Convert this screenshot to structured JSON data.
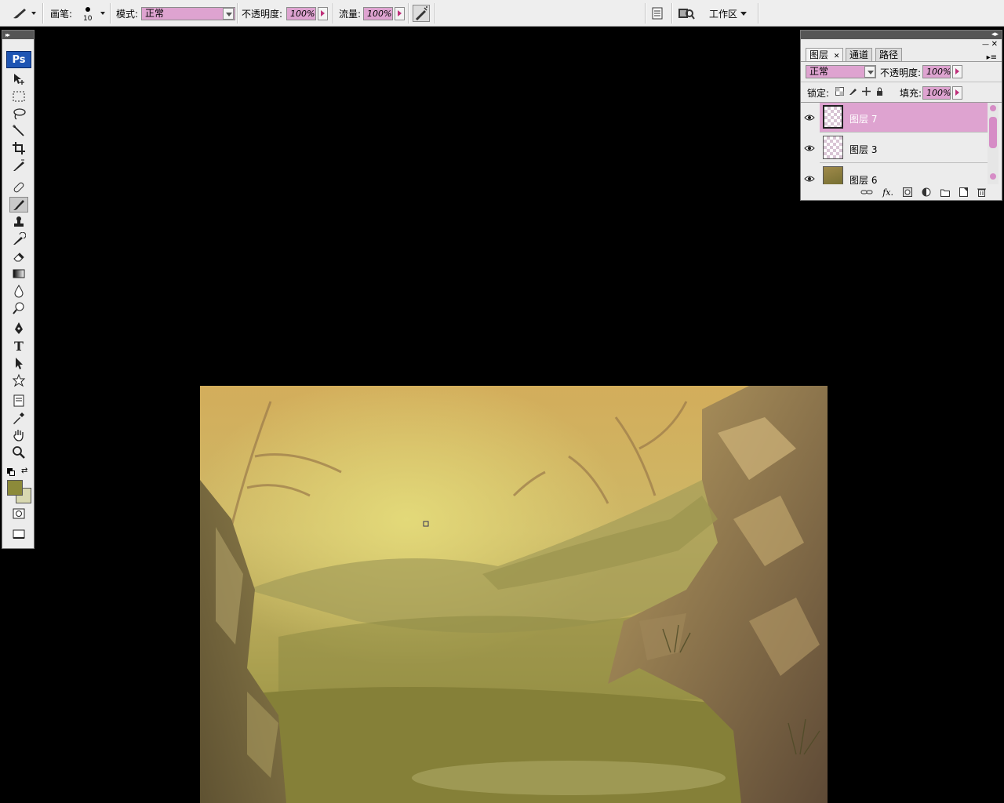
{
  "options_bar": {
    "brush_label": "画笔:",
    "brush_size": "10",
    "mode_label": "模式:",
    "mode_value": "正常",
    "opacity_label": "不透明度:",
    "opacity_value": "100%",
    "flow_label": "流量:",
    "flow_value": "100%",
    "workspace_label": "工作区"
  },
  "tools": {
    "logo": "Ps",
    "items": [
      "move-tool",
      "rectangular-marquee-tool",
      "lasso-tool",
      "magic-wand-tool",
      "crop-tool",
      "slice-tool",
      "healing-brush-tool",
      "brush-tool",
      "clone-stamp-tool",
      "history-brush-tool",
      "eraser-tool",
      "gradient-tool",
      "blur-tool",
      "dodge-tool",
      "pen-tool",
      "type-tool",
      "path-selection-tool",
      "custom-shape-tool",
      "notes-tool",
      "eyedropper-tool",
      "hand-tool",
      "zoom-tool"
    ],
    "selected": "brush-tool",
    "text_tool_glyph": "T",
    "foreground_color": "#8c8a3a",
    "background_color": "#d8d8b0"
  },
  "layers_panel": {
    "tabs": [
      {
        "label": "图层",
        "active": true
      },
      {
        "label": "通道",
        "active": false
      },
      {
        "label": "路径",
        "active": false
      }
    ],
    "blend_mode": "正常",
    "opacity_label": "不透明度:",
    "opacity_value": "100%",
    "lock_label": "锁定:",
    "fill_label": "填充:",
    "fill_value": "100%",
    "layers": [
      {
        "name": "图层 7",
        "selected": true,
        "visible": true
      },
      {
        "name": "图层 3",
        "selected": false,
        "visible": true
      },
      {
        "name": "图层 6",
        "selected": false,
        "visible": true
      }
    ]
  },
  "colors": {
    "accent_pink": "#dea3d0",
    "panel_bg": "#ececec",
    "workspace_bg": "#000000"
  }
}
